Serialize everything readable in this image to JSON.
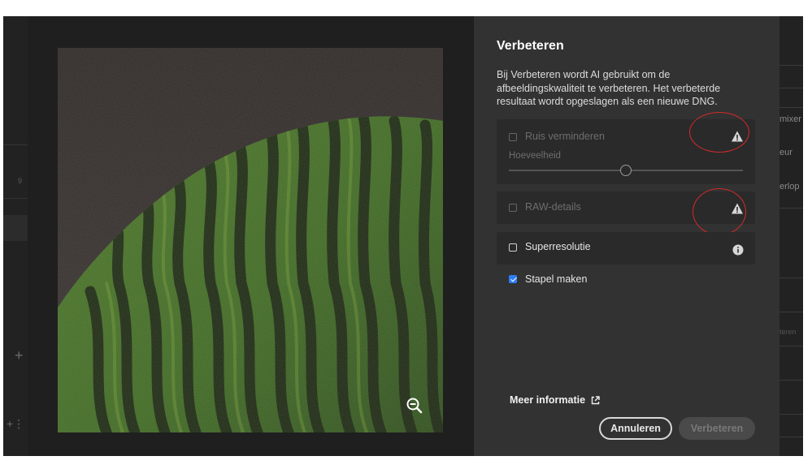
{
  "dialog": {
    "title": "Verbeteren",
    "description": "Bij Verbeteren wordt AI gebruikt om de afbeeldingskwaliteit te verbeteren. Het verbeterde resultaat wordt opgeslagen als een nieuwe DNG.",
    "options": {
      "noise": {
        "label": "Ruis verminderen",
        "checked": false,
        "enabled": false,
        "icon": "warning-icon"
      },
      "amount": {
        "label": "Hoeveelheid",
        "value": 50
      },
      "raw": {
        "label": "RAW-details",
        "checked": false,
        "enabled": false,
        "icon": "warning-icon"
      },
      "super": {
        "label": "Superresolutie",
        "checked": false,
        "enabled": true,
        "icon": "info-icon"
      },
      "stack": {
        "label": "Stapel maken",
        "checked": true,
        "enabled": true
      }
    },
    "more_info": "Meer informatie",
    "cancel_label": "Annuleren",
    "enhance_label": "Verbeteren"
  },
  "background_right_labels": [
    "mixer",
    "eur",
    "erlop",
    "teren"
  ],
  "background_left_number": "9",
  "colors": {
    "accent": "#2d7ef5",
    "panel": "#323232",
    "annotation": "#d42a2a"
  }
}
